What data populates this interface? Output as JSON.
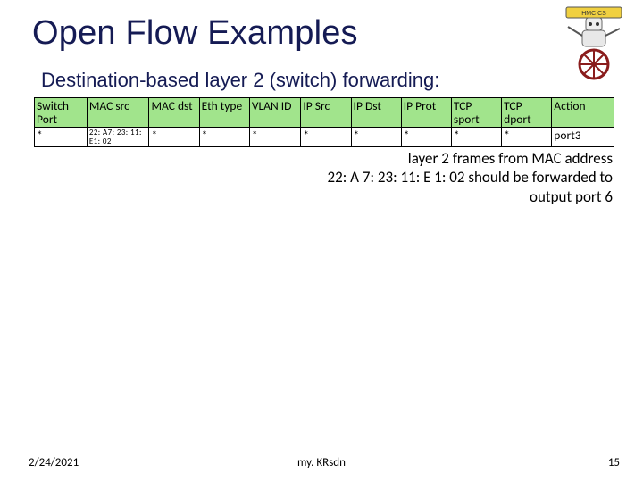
{
  "title": "Open Flow Examples",
  "subtitle": "Destination-based layer 2 (switch) forwarding:",
  "table": {
    "headers": [
      "Switch Port",
      "MAC src",
      "MAC dst",
      "Eth type",
      "VLAN ID",
      "IP Src",
      "IP Dst",
      "IP Prot",
      "TCP sport",
      "TCP dport",
      "Action"
    ],
    "row": {
      "switch_port": "*",
      "mac_src": "22: A7: 23: 11: E1: 02",
      "mac_dst": "*",
      "eth_type": "*",
      "vlan_id": "*",
      "ip_src": "*",
      "ip_dst": "*",
      "ip_prot": "*",
      "tcp_sport": "*",
      "tcp_dport": "*",
      "action": "port3"
    }
  },
  "caption_line1": "layer 2 frames from MAC address",
  "caption_line2": "22: A 7: 23: 11: E 1: 02 should be forwarded to",
  "caption_line3": "output port 6",
  "footer": {
    "date": "2/24/2021",
    "center": "my. KRsdn",
    "page": "15"
  },
  "robot": {
    "label": "HMC   CS"
  }
}
